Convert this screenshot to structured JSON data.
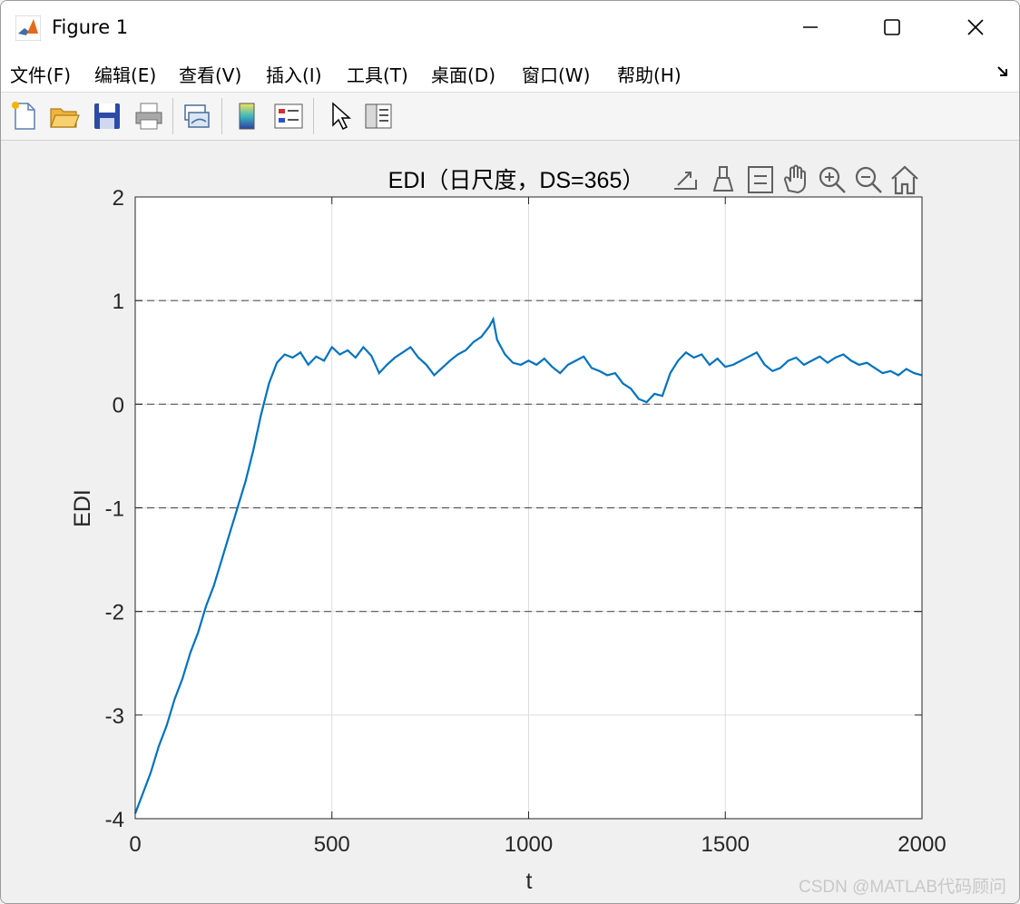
{
  "window": {
    "title": "Figure 1",
    "controls": [
      "minimize-icon",
      "maximize-icon",
      "close-icon"
    ]
  },
  "menubar": {
    "items": [
      {
        "label": "文件(F)"
      },
      {
        "label": "编辑(E)"
      },
      {
        "label": "查看(V)"
      },
      {
        "label": "插入(I)"
      },
      {
        "label": "工具(T)"
      },
      {
        "label": "桌面(D)"
      },
      {
        "label": "窗口(W)"
      },
      {
        "label": "帮助(H)"
      }
    ],
    "overflow_icon": "dock-arrow-icon"
  },
  "toolbar": {
    "buttons": [
      "new-figure-icon",
      "open-file-icon",
      "save-icon",
      "print-icon",
      "link-plot-icon",
      "insert-colorbar-icon",
      "insert-legend-icon",
      "edit-plot-pointer-icon",
      "property-inspector-icon"
    ]
  },
  "axes_toolbar": {
    "buttons": [
      "export-icon",
      "brush-icon",
      "data-tips-icon",
      "pan-hand-icon",
      "zoom-in-icon",
      "zoom-out-icon",
      "restore-view-home-icon"
    ]
  },
  "colors": {
    "line": "#0072BD",
    "grid": "#dedede",
    "dashed_ref": "#555555"
  },
  "chart_data": {
    "type": "line",
    "title": "EDI（日尺度，DS=365）",
    "xlabel": "t",
    "ylabel": "EDI",
    "xlim": [
      0,
      2000
    ],
    "ylim": [
      -4,
      2
    ],
    "xticks": [
      0,
      500,
      1000,
      1500,
      2000
    ],
    "yticks": [
      -4,
      -3,
      -2,
      -1,
      0,
      1,
      2
    ],
    "xtick_labels": [
      "0",
      "500",
      "1000",
      "1500",
      "2000"
    ],
    "ytick_labels": [
      "-4",
      "-3",
      "-2",
      "-1",
      "0",
      "1",
      "2"
    ],
    "grid": true,
    "reference_lines": [
      {
        "y": 1,
        "style": "dashed"
      },
      {
        "y": 0,
        "style": "dashed"
      },
      {
        "y": -1,
        "style": "dashed"
      },
      {
        "y": -2,
        "style": "dashed"
      }
    ],
    "series": [
      {
        "color": "#0072BD",
        "x": [
          0,
          20,
          40,
          60,
          80,
          100,
          120,
          140,
          160,
          180,
          200,
          220,
          240,
          260,
          280,
          300,
          320,
          340,
          360,
          380,
          400,
          420,
          440,
          460,
          480,
          500,
          520,
          540,
          560,
          580,
          600,
          620,
          640,
          660,
          680,
          700,
          720,
          740,
          760,
          780,
          800,
          820,
          840,
          860,
          880,
          900,
          910,
          920,
          940,
          960,
          980,
          1000,
          1020,
          1040,
          1060,
          1080,
          1100,
          1120,
          1140,
          1160,
          1180,
          1200,
          1220,
          1240,
          1260,
          1280,
          1300,
          1320,
          1340,
          1360,
          1380,
          1400,
          1420,
          1440,
          1460,
          1480,
          1500,
          1520,
          1540,
          1560,
          1580,
          1600,
          1620,
          1640,
          1660,
          1680,
          1700,
          1720,
          1740,
          1760,
          1780,
          1800,
          1820,
          1840,
          1860,
          1880,
          1900,
          1920,
          1940,
          1960,
          1980,
          2000
        ],
        "y": [
          -3.95,
          -3.75,
          -3.55,
          -3.3,
          -3.1,
          -2.85,
          -2.65,
          -2.4,
          -2.2,
          -1.95,
          -1.75,
          -1.5,
          -1.25,
          -1.0,
          -0.75,
          -0.45,
          -0.1,
          0.2,
          0.4,
          0.48,
          0.45,
          0.5,
          0.38,
          0.46,
          0.42,
          0.55,
          0.48,
          0.52,
          0.45,
          0.55,
          0.47,
          0.3,
          0.38,
          0.45,
          0.5,
          0.55,
          0.45,
          0.38,
          0.28,
          0.35,
          0.42,
          0.48,
          0.52,
          0.6,
          0.65,
          0.75,
          0.82,
          0.62,
          0.48,
          0.4,
          0.38,
          0.42,
          0.38,
          0.44,
          0.36,
          0.3,
          0.38,
          0.42,
          0.46,
          0.35,
          0.32,
          0.28,
          0.3,
          0.2,
          0.15,
          0.05,
          0.02,
          0.1,
          0.08,
          0.3,
          0.42,
          0.5,
          0.45,
          0.48,
          0.38,
          0.44,
          0.36,
          0.38,
          0.42,
          0.46,
          0.5,
          0.38,
          0.32,
          0.35,
          0.42,
          0.45,
          0.38,
          0.42,
          0.46,
          0.4,
          0.45,
          0.48,
          0.42,
          0.38,
          0.4,
          0.35,
          0.3,
          0.32,
          0.28,
          0.34,
          0.3,
          0.28
        ]
      }
    ]
  },
  "watermark": "CSDN @MATLAB代码顾问"
}
